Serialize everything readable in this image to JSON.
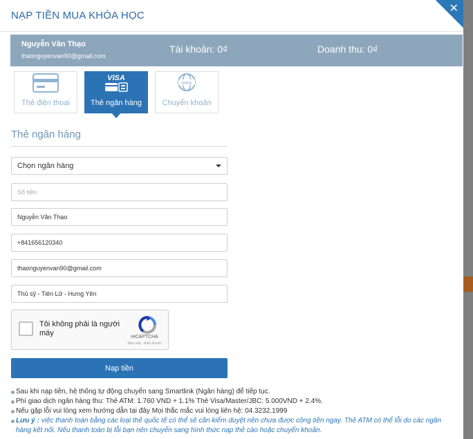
{
  "modal": {
    "title": "NẠP TIỀN MUA KHÓA HỌC",
    "close_glyph": "✕"
  },
  "user": {
    "name": "Nguyễn Văn Thạo",
    "email": "thaonguyenvan90@gmail.com",
    "account_label": "Tài khoản: 0₫",
    "revenue_label": "Doanh thu: 0₫"
  },
  "tabs": [
    {
      "label": "Thẻ điện thoại",
      "icon": "card-icon",
      "active": false
    },
    {
      "label": "Thẻ ngân hàng",
      "icon": "visa-icon",
      "active": true
    },
    {
      "label": "Chuyển khoản",
      "icon": "globe-icon",
      "active": false
    }
  ],
  "visa_text": "VISA",
  "www_text": "www",
  "form": {
    "section_title": "Thẻ ngân hàng",
    "bank_select": "Chọn ngân hàng",
    "amount_placeholder": "Số tiền",
    "name_value": "Nguyễn Văn Thạo",
    "phone_value": "+841656120340",
    "email_value": "thaonguyenvan90@gmail.com",
    "address_value": "Thủ sỹ - Tiên Lữ - Hưng Yên",
    "captcha_label": "Tôi không phải là người máy",
    "captcha_brand": "reCAPTCHA",
    "captcha_links": "Bảo mật - Điều khoản",
    "submit_label": "Nạp tiền"
  },
  "notes": {
    "line1": "Sau khi nạp tiền, hệ thống tự động chuyển sang Smartlink (Ngân hàng) để tiếp tục.",
    "line2": "Phí giao dịch ngân hàng thu: Thẻ ATM: 1.760 VND + 1.1% Thẻ Visa/Master/JBC: 5.000VND + 2.4%.",
    "line3": "Nếu gặp lỗi vui lòng xem hướng dẫn tại đây Mọi thắc mắc vui lòng liên hệ: 04.3232.1999",
    "warning_label": "Lưu ý :",
    "warning_text": " việc thanh toán bằng các loại thẻ quốc tế có thể sẽ cần kiểm duyệt nên chưa được cộng tiền ngay. Thẻ ATM có thể lỗi do các ngân hàng kết nối. Nếu thanh toán bị lỗi bạn nên chuyển sang hình thức nạp thẻ cào hoặc chuyển khoản."
  },
  "colors": {
    "primary": "#2b73b5",
    "info_bar": "#8ea6bc",
    "title": "#2a6aa8"
  }
}
